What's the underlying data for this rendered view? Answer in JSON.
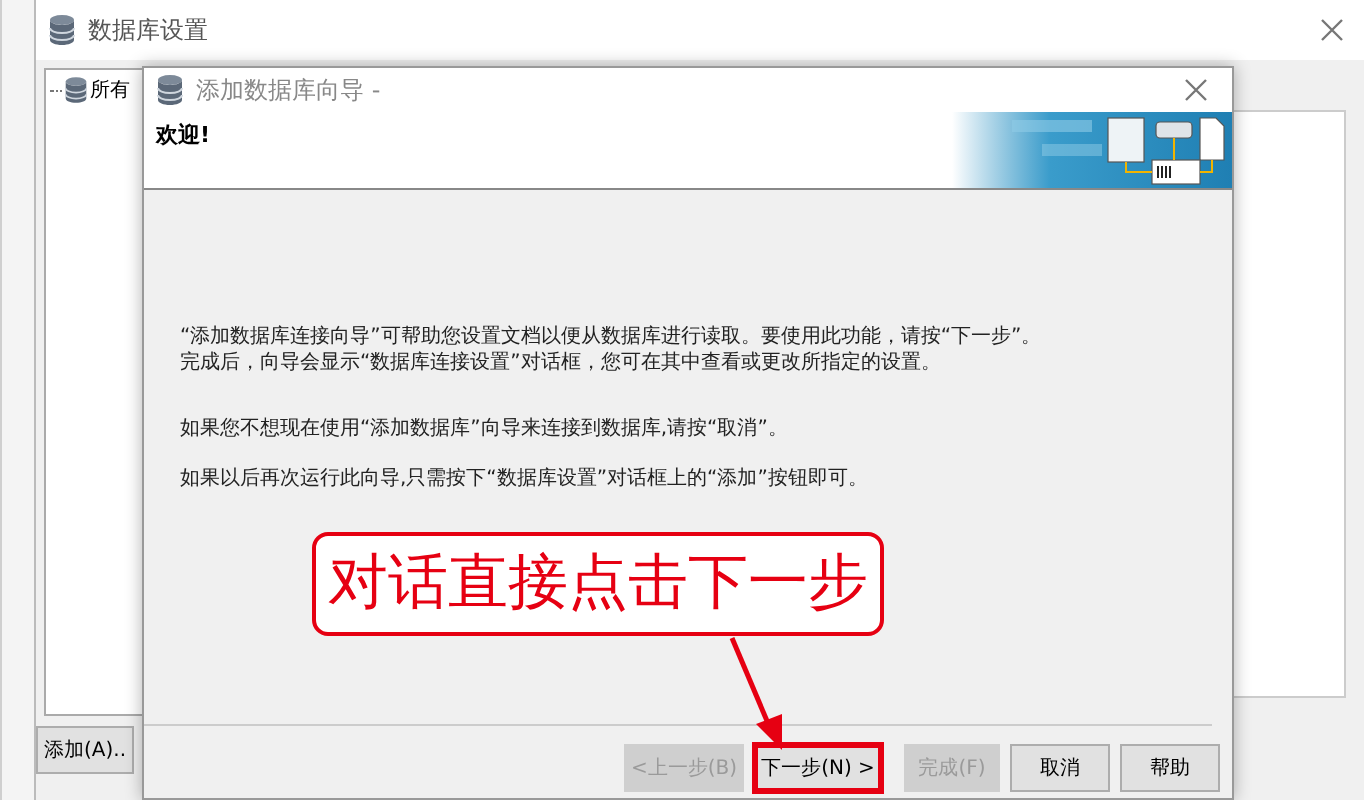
{
  "main_window": {
    "title": "数据库设置",
    "tree": {
      "items": [
        {
          "label": "所有"
        }
      ]
    },
    "buttons": [
      {
        "label": "添加(A).."
      }
    ]
  },
  "wizard": {
    "title": "添加数据库向导 -",
    "heading": "欢迎!",
    "paragraphs": [
      "“添加数据库连接向导”可帮助您设置文档以便从数据库进行读取。要使用此功能，请按“下一步”。完成后，向导会显示“数据库连接设置”对话框，您可在其中查看或更改所指定的设置。",
      "如果您不想现在使用“添加数据库”向导来连接到数据库,请按“取消”。",
      "如果以后再次运行此向导,只需按下“数据库设置”对话框上的“添加”按钮即可。"
    ],
    "buttons": [
      {
        "label": "<上一步(B)",
        "disabled": true,
        "highlighted": false
      },
      {
        "label": "下一步(N) >",
        "disabled": false,
        "highlighted": true
      },
      {
        "label": "完成(F)",
        "disabled": true,
        "highlighted": false
      },
      {
        "label": "取消",
        "disabled": false,
        "highlighted": false
      },
      {
        "label": "帮助",
        "disabled": false,
        "highlighted": false
      }
    ]
  },
  "annotation": {
    "text": "对话直接点击下一步"
  }
}
